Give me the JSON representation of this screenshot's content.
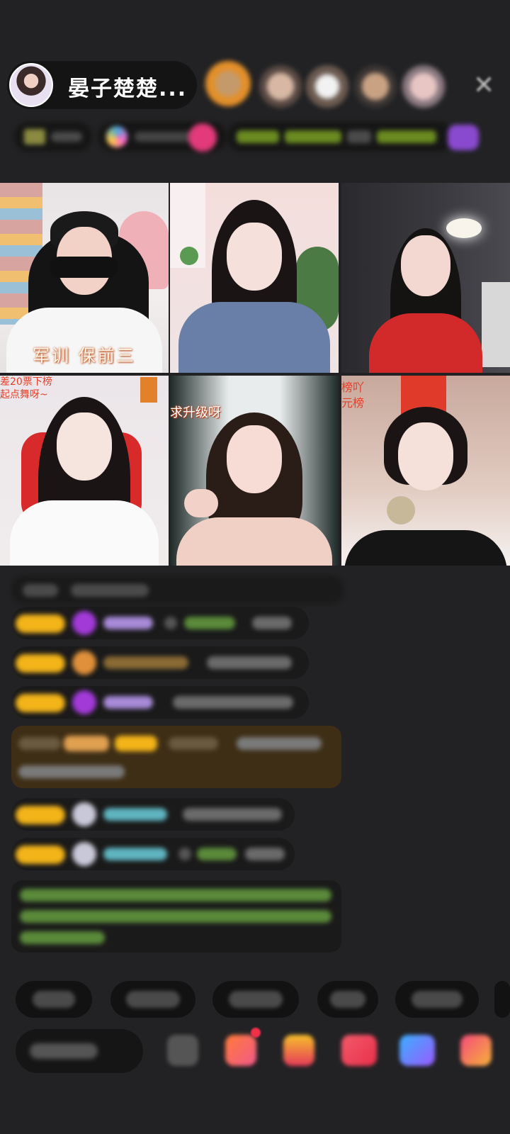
{
  "host": {
    "name": "晏子楚楚..."
  },
  "viewers": [
    {
      "icon": "viewer-avatar"
    },
    {
      "icon": "viewer-avatar"
    },
    {
      "icon": "viewer-avatar"
    },
    {
      "icon": "viewer-avatar"
    },
    {
      "icon": "viewer-avatar"
    }
  ],
  "close_icon": "✕",
  "video_grid": {
    "tiles": [
      {
        "caption": "军训  保前三",
        "tag": ""
      },
      {
        "caption": "",
        "tag": ""
      },
      {
        "caption": "",
        "tag": ""
      },
      {
        "caption": "",
        "tag": "差20票下榜\n起点舞呀~"
      },
      {
        "caption": "",
        "tag": "求升级呀"
      },
      {
        "caption": "",
        "tag": "榜吖\n元榜"
      }
    ]
  },
  "colors": {
    "background": "#222224",
    "level_badge": "#f3b419",
    "chat_bubble": "#1a1a1a",
    "highlight_bubble": "#4a3618",
    "green_text": "#7cc46a",
    "purple_name": "#a78ad8",
    "teal_name": "#5fb4c0"
  },
  "icons": {
    "close": "close-icon",
    "gift": "gift-icon",
    "lightning": "lightning-icon",
    "heart": "heart-icon",
    "game": "game-icon",
    "more": "more-icon"
  }
}
